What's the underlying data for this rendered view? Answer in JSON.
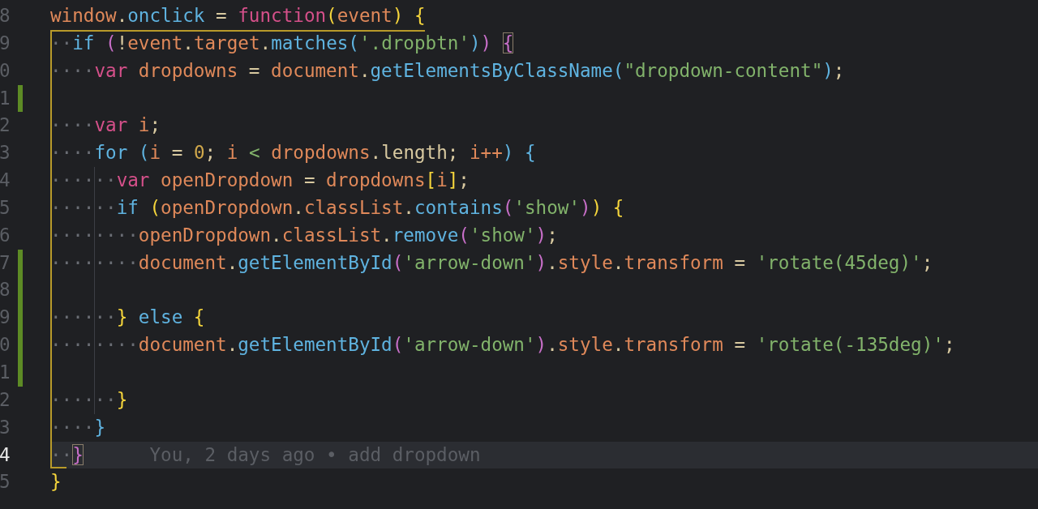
{
  "editor": {
    "lines": [
      {
        "number": "8",
        "current": false,
        "modified": false,
        "tokens": [
          {
            "kind": "variable",
            "text": "window"
          },
          {
            "kind": "punct",
            "text": "."
          },
          {
            "kind": "method",
            "text": "onclick"
          },
          {
            "kind": "operator",
            "text": " = "
          },
          {
            "kind": "keyword",
            "text": "function"
          },
          {
            "kind": "bracket1",
            "text": "("
          },
          {
            "kind": "variable",
            "text": "event"
          },
          {
            "kind": "bracket1",
            "text": ")"
          },
          {
            "kind": "bracket1",
            "text": " {"
          }
        ]
      },
      {
        "number": "9",
        "current": false,
        "modified": false,
        "tokens": [
          {
            "kind": "whitespace",
            "text": "··"
          },
          {
            "kind": "control",
            "text": "if"
          },
          {
            "kind": "bracket2",
            "text": " ("
          },
          {
            "kind": "operator",
            "text": "!"
          },
          {
            "kind": "variable",
            "text": "event"
          },
          {
            "kind": "punct",
            "text": "."
          },
          {
            "kind": "property",
            "text": "target"
          },
          {
            "kind": "punct",
            "text": "."
          },
          {
            "kind": "method",
            "text": "matches"
          },
          {
            "kind": "bracket3",
            "text": "("
          },
          {
            "kind": "string",
            "text": "'.dropbtn'"
          },
          {
            "kind": "bracket3",
            "text": ")"
          },
          {
            "kind": "bracket2",
            "text": ") "
          },
          {
            "kind": "bracket2",
            "text": "{",
            "matched": true
          }
        ]
      },
      {
        "number": "0",
        "current": false,
        "modified": false,
        "tokens": [
          {
            "kind": "whitespace",
            "text": "····"
          },
          {
            "kind": "keyword",
            "text": "var"
          },
          {
            "kind": "variable",
            "text": " dropdowns"
          },
          {
            "kind": "operator",
            "text": " = "
          },
          {
            "kind": "variable",
            "text": "document"
          },
          {
            "kind": "punct",
            "text": "."
          },
          {
            "kind": "method",
            "text": "getElementsByClassName"
          },
          {
            "kind": "bracket3",
            "text": "("
          },
          {
            "kind": "string",
            "text": "\"dropdown-content\""
          },
          {
            "kind": "bracket3",
            "text": ")"
          },
          {
            "kind": "punct",
            "text": ";"
          }
        ]
      },
      {
        "number": "1",
        "current": false,
        "modified": true
      },
      {
        "number": "2",
        "current": false,
        "modified": false,
        "tokens": [
          {
            "kind": "whitespace",
            "text": "····"
          },
          {
            "kind": "keyword",
            "text": "var"
          },
          {
            "kind": "variable",
            "text": " i"
          },
          {
            "kind": "punct",
            "text": ";"
          }
        ]
      },
      {
        "number": "3",
        "current": false,
        "modified": false,
        "tokens": [
          {
            "kind": "whitespace",
            "text": "····"
          },
          {
            "kind": "control",
            "text": "for"
          },
          {
            "kind": "bracket3",
            "text": " ("
          },
          {
            "kind": "variable",
            "text": "i"
          },
          {
            "kind": "operator",
            "text": " = "
          },
          {
            "kind": "number",
            "text": "0"
          },
          {
            "kind": "punct",
            "text": "; "
          },
          {
            "kind": "variable",
            "text": "i"
          },
          {
            "kind": "comparison",
            "text": " < "
          },
          {
            "kind": "variable",
            "text": "dropdowns"
          },
          {
            "kind": "punct",
            "text": "."
          },
          {
            "kind": "length",
            "text": "length"
          },
          {
            "kind": "punct",
            "text": "; "
          },
          {
            "kind": "variable",
            "text": "i++"
          },
          {
            "kind": "bracket3",
            "text": ")"
          },
          {
            "kind": "bracket3",
            "text": " {"
          }
        ]
      },
      {
        "number": "4",
        "current": false,
        "modified": false,
        "tokens": [
          {
            "kind": "whitespace",
            "text": "······"
          },
          {
            "kind": "keyword",
            "text": "var"
          },
          {
            "kind": "variable",
            "text": " openDropdown"
          },
          {
            "kind": "operator",
            "text": " = "
          },
          {
            "kind": "variable",
            "text": "dropdowns"
          },
          {
            "kind": "bracket1",
            "text": "["
          },
          {
            "kind": "variable",
            "text": "i"
          },
          {
            "kind": "bracket1",
            "text": "]"
          },
          {
            "kind": "punct",
            "text": ";"
          }
        ]
      },
      {
        "number": "5",
        "current": false,
        "modified": false,
        "tokens": [
          {
            "kind": "whitespace",
            "text": "······"
          },
          {
            "kind": "control",
            "text": "if"
          },
          {
            "kind": "bracket1",
            "text": " ("
          },
          {
            "kind": "variable",
            "text": "openDropdown"
          },
          {
            "kind": "punct",
            "text": "."
          },
          {
            "kind": "property",
            "text": "classList"
          },
          {
            "kind": "punct",
            "text": "."
          },
          {
            "kind": "method",
            "text": "contains"
          },
          {
            "kind": "bracket2",
            "text": "("
          },
          {
            "kind": "string",
            "text": "'show'"
          },
          {
            "kind": "bracket2",
            "text": ")"
          },
          {
            "kind": "bracket1",
            "text": ")"
          },
          {
            "kind": "bracket1",
            "text": " {"
          }
        ]
      },
      {
        "number": "6",
        "current": false,
        "modified": false,
        "tokens": [
          {
            "kind": "whitespace",
            "text": "········"
          },
          {
            "kind": "variable",
            "text": "openDropdown"
          },
          {
            "kind": "punct",
            "text": "."
          },
          {
            "kind": "property",
            "text": "classList"
          },
          {
            "kind": "punct",
            "text": "."
          },
          {
            "kind": "method",
            "text": "remove"
          },
          {
            "kind": "bracket2",
            "text": "("
          },
          {
            "kind": "string",
            "text": "'show'"
          },
          {
            "kind": "bracket2",
            "text": ")"
          },
          {
            "kind": "punct",
            "text": ";"
          }
        ]
      },
      {
        "number": "7",
        "current": false,
        "modified": true,
        "tokens": [
          {
            "kind": "whitespace",
            "text": "········"
          },
          {
            "kind": "variable",
            "text": "document"
          },
          {
            "kind": "punct",
            "text": "."
          },
          {
            "kind": "method",
            "text": "getElementById"
          },
          {
            "kind": "bracket2",
            "text": "("
          },
          {
            "kind": "string",
            "text": "'arrow-down'"
          },
          {
            "kind": "bracket2",
            "text": ")"
          },
          {
            "kind": "punct",
            "text": "."
          },
          {
            "kind": "property",
            "text": "style"
          },
          {
            "kind": "punct",
            "text": "."
          },
          {
            "kind": "property",
            "text": "transform"
          },
          {
            "kind": "operator",
            "text": " = "
          },
          {
            "kind": "string",
            "text": "'rotate(45deg)'"
          },
          {
            "kind": "punct",
            "text": ";"
          }
        ]
      },
      {
        "number": "8",
        "current": false,
        "modified": true
      },
      {
        "number": "9",
        "current": false,
        "modified": true,
        "tokens": [
          {
            "kind": "whitespace",
            "text": "······"
          },
          {
            "kind": "bracket1",
            "text": "}"
          },
          {
            "kind": "control",
            "text": " else"
          },
          {
            "kind": "bracket1",
            "text": " {"
          }
        ]
      },
      {
        "number": "0",
        "current": false,
        "modified": true,
        "tokens": [
          {
            "kind": "whitespace",
            "text": "········"
          },
          {
            "kind": "variable",
            "text": "document"
          },
          {
            "kind": "punct",
            "text": "."
          },
          {
            "kind": "method",
            "text": "getElementById"
          },
          {
            "kind": "bracket2",
            "text": "("
          },
          {
            "kind": "string",
            "text": "'arrow-down'"
          },
          {
            "kind": "bracket2",
            "text": ")"
          },
          {
            "kind": "punct",
            "text": "."
          },
          {
            "kind": "property",
            "text": "style"
          },
          {
            "kind": "punct",
            "text": "."
          },
          {
            "kind": "property",
            "text": "transform"
          },
          {
            "kind": "operator",
            "text": " = "
          },
          {
            "kind": "string",
            "text": "'rotate(-135deg)'"
          },
          {
            "kind": "punct",
            "text": ";"
          }
        ]
      },
      {
        "number": "1",
        "current": false,
        "modified": true
      },
      {
        "number": "2",
        "current": false,
        "modified": false,
        "tokens": [
          {
            "kind": "whitespace",
            "text": "······"
          },
          {
            "kind": "bracket1",
            "text": "}"
          }
        ]
      },
      {
        "number": "3",
        "current": false,
        "modified": false,
        "tokens": [
          {
            "kind": "whitespace",
            "text": "····"
          },
          {
            "kind": "bracket3",
            "text": "}"
          }
        ]
      },
      {
        "number": "4",
        "current": true,
        "modified": false,
        "tokens": [
          {
            "kind": "whitespace",
            "text": "··"
          },
          {
            "kind": "bracket2",
            "text": "}",
            "matched": true
          }
        ],
        "blame": "You, 2 days ago • add dropdown"
      },
      {
        "number": "5",
        "current": false,
        "modified": false,
        "tokens": [
          {
            "kind": "bracket1",
            "text": "}"
          }
        ]
      }
    ]
  }
}
